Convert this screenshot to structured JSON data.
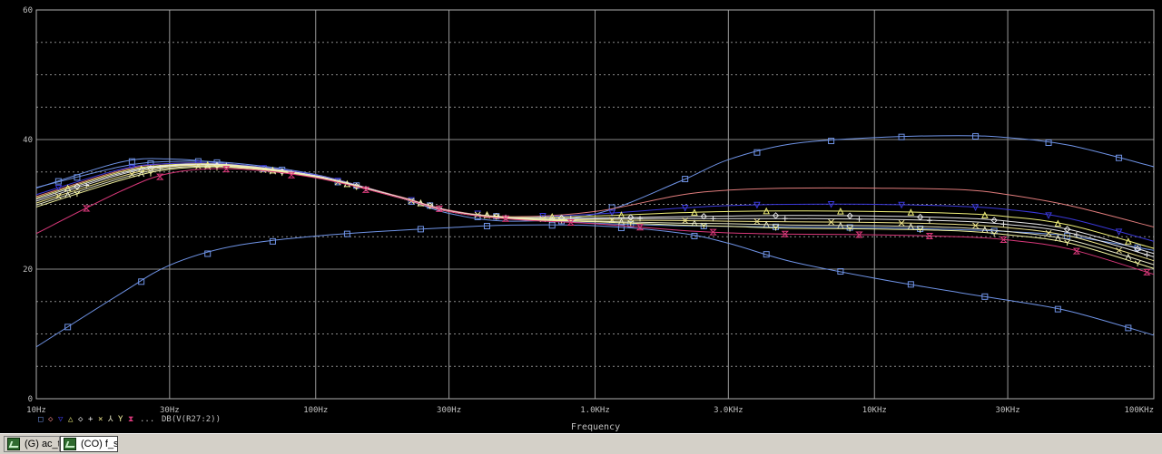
{
  "chart_data": {
    "type": "line",
    "xscale": "log",
    "xlim": [
      10,
      100000
    ],
    "ylim": [
      0,
      60
    ],
    "xlabel": "Frequency",
    "ylabel": "",
    "grid": true,
    "x_ticks": [
      {
        "value": 10,
        "label": "10Hz"
      },
      {
        "value": 30,
        "label": "30Hz"
      },
      {
        "value": 100,
        "label": "100Hz"
      },
      {
        "value": 300,
        "label": "300Hz"
      },
      {
        "value": 1000,
        "label": "1.0KHz"
      },
      {
        "value": 3000,
        "label": "3.0KHz"
      },
      {
        "value": 10000,
        "label": "10KHz"
      },
      {
        "value": 30000,
        "label": "30KHz"
      },
      {
        "value": 100000,
        "label": "100KHz"
      }
    ],
    "y_ticks": [
      {
        "value": 0,
        "label": "0"
      },
      {
        "value": 20,
        "label": "20"
      },
      {
        "value": 40,
        "label": "40"
      },
      {
        "value": 60,
        "label": "60"
      }
    ],
    "legend": {
      "markers": [
        "□",
        "◇",
        "▽",
        "△",
        "◇",
        "+",
        "×",
        "⅄",
        "Y",
        "⧗"
      ],
      "ellipsis": "...",
      "expression": "DB(V(R27:2))",
      "position": "bottom-left"
    },
    "x": [
      10,
      20,
      30,
      50,
      100,
      200,
      300,
      500,
      1000,
      2000,
      3000,
      5000,
      10000,
      20000,
      30000,
      50000,
      100000
    ],
    "series": [
      {
        "color": "#6f93e6",
        "marker": "square",
        "values": [
          32.5,
          36.5,
          37.0,
          36.2,
          34.3,
          31.0,
          28.6,
          27.4,
          28.5,
          33.5,
          36.9,
          39.3,
          40.3,
          40.6,
          40.3,
          39.1,
          35.8
        ]
      },
      {
        "color": "#6f93e6",
        "marker": "square",
        "values": [
          8.0,
          16.2,
          20.6,
          23.5,
          25.1,
          26.0,
          26.4,
          26.8,
          26.7,
          25.6,
          24.0,
          21.2,
          18.6,
          16.4,
          15.2,
          13.5,
          9.8
        ]
      },
      {
        "color": "#6f93e6",
        "marker": "square",
        "values": [
          32.6,
          35.8,
          36.6,
          36.4,
          34.6,
          31.1,
          29.0,
          27.9,
          27.1,
          26.7,
          26.6,
          26.5,
          26.4,
          26.1,
          25.8,
          25.1,
          22.9
        ]
      },
      {
        "color": "#e07c7c",
        "marker": "none",
        "values": [
          31.2,
          35.2,
          36.3,
          36.2,
          34.5,
          31.2,
          29.1,
          28.1,
          28.9,
          31.4,
          32.2,
          32.5,
          32.5,
          32.3,
          31.5,
          29.8,
          26.5
        ]
      },
      {
        "color": "#3a38d9",
        "marker": "triangle-down",
        "values": [
          31.5,
          35.4,
          36.3,
          36.2,
          34.5,
          31.1,
          29.0,
          28.0,
          28.5,
          29.4,
          29.8,
          30.0,
          30.0,
          29.7,
          29.2,
          27.8,
          24.3
        ]
      },
      {
        "color": "#f0f07a",
        "marker": "triangle-up",
        "values": [
          31.0,
          35.0,
          36.1,
          36.1,
          34.4,
          31.1,
          29.0,
          28.0,
          28.2,
          28.7,
          28.9,
          29.0,
          28.9,
          28.6,
          28.1,
          26.8,
          23.2
        ]
      },
      {
        "color": "#e8e8e8",
        "marker": "diamond",
        "values": [
          30.8,
          34.8,
          36.0,
          36.0,
          34.4,
          31.1,
          29.0,
          27.9,
          27.9,
          28.1,
          28.2,
          28.3,
          28.2,
          27.9,
          27.4,
          26.1,
          22.4
        ]
      },
      {
        "color": "#e8e8e8",
        "marker": "plus",
        "values": [
          30.5,
          34.6,
          35.9,
          36.0,
          34.4,
          31.1,
          29.0,
          27.9,
          27.8,
          27.8,
          27.8,
          27.8,
          27.7,
          27.4,
          26.9,
          25.6,
          21.9
        ]
      },
      {
        "color": "#f0e68c",
        "marker": "cross",
        "values": [
          30.2,
          34.3,
          35.8,
          35.9,
          34.3,
          31.0,
          28.9,
          27.8,
          27.6,
          27.5,
          27.4,
          27.3,
          27.2,
          26.9,
          26.4,
          25.1,
          21.3
        ]
      },
      {
        "color": "#e8e8c8",
        "marker": "lambda",
        "values": [
          29.9,
          34.0,
          35.6,
          35.8,
          34.3,
          31.0,
          28.9,
          27.8,
          27.4,
          27.1,
          27.0,
          26.8,
          26.7,
          26.4,
          25.8,
          24.5,
          20.7
        ]
      },
      {
        "color": "#f5f5a0",
        "marker": "y",
        "values": [
          29.6,
          33.7,
          35.4,
          35.7,
          34.2,
          31.0,
          28.9,
          27.8,
          27.3,
          26.8,
          26.6,
          26.3,
          26.2,
          25.9,
          25.3,
          24.0,
          20.1
        ]
      },
      {
        "color": "#d9387a",
        "marker": "hourglass",
        "values": [
          25.5,
          32.0,
          34.8,
          35.5,
          34.1,
          31.0,
          28.9,
          27.7,
          27.0,
          26.0,
          25.6,
          25.4,
          25.3,
          25.0,
          24.5,
          23.1,
          19.2
        ]
      }
    ]
  },
  "taskbar": {
    "tabs": [
      {
        "label": "(G) ac_time",
        "active": false
      },
      {
        "label": "(CO) f_swep ...",
        "active": true
      }
    ]
  }
}
